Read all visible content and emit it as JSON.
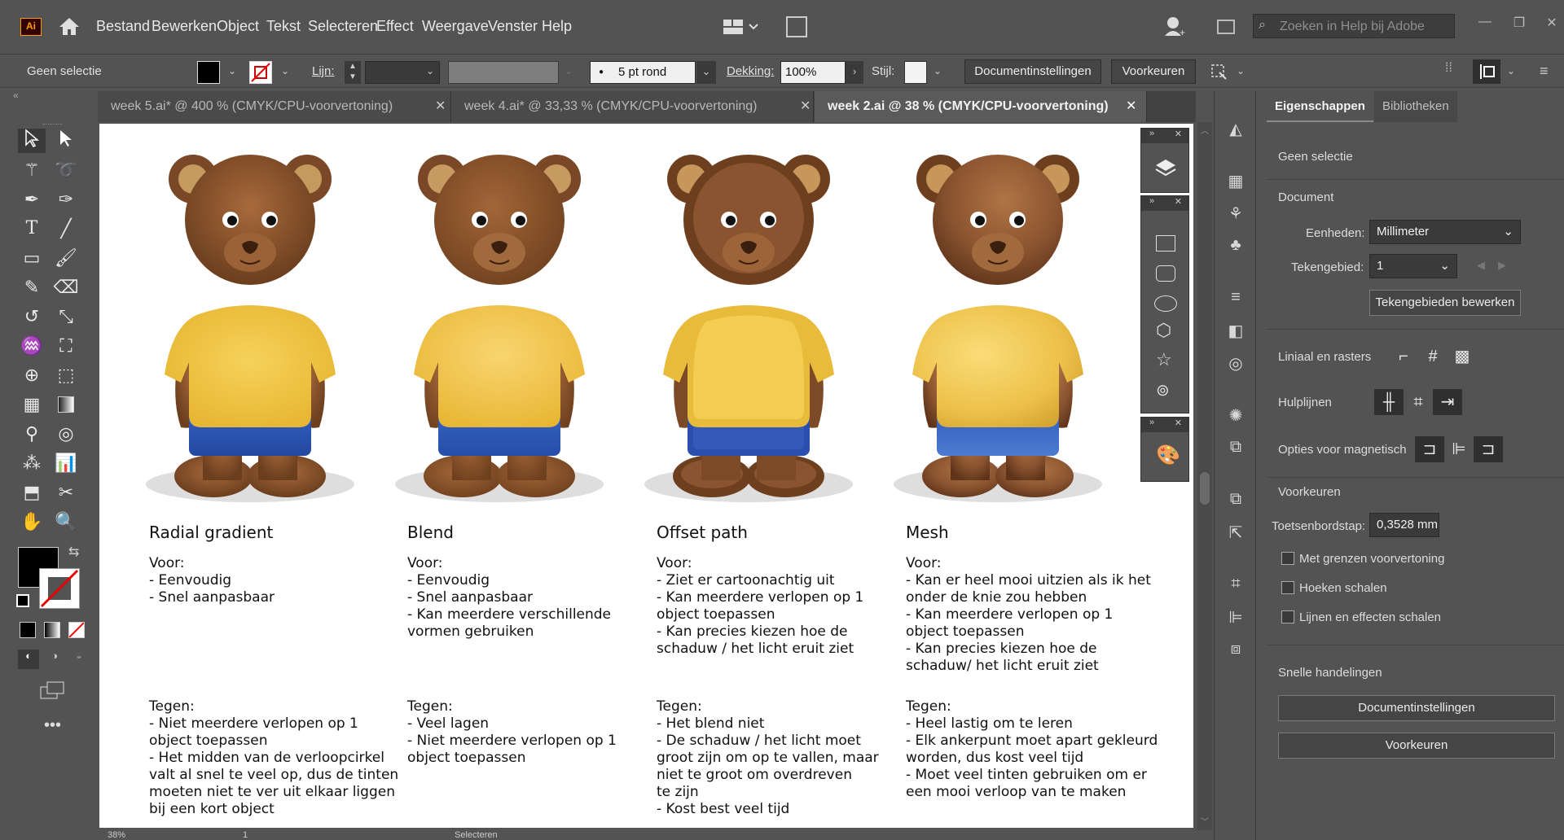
{
  "app": {
    "logo": "Ai"
  },
  "menu": [
    "Bestand",
    "Bewerken",
    "Object",
    "Tekst",
    "Selecteren",
    "Effect",
    "Weergave",
    "Venster",
    "Help"
  ],
  "search": {
    "placeholder": "Zoeken in Help bij Adobe"
  },
  "control": {
    "selection_label": "Geen selectie",
    "stroke_label": "Lijn:",
    "brush_value": "5 pt rond",
    "opacity_label": "Dekking:",
    "opacity_value": "100%",
    "style_label": "Stijl:",
    "doc_settings": "Documentinstellingen",
    "preferences": "Voorkeuren"
  },
  "tabs": [
    {
      "label": "week 5.ai* @ 400 % (CMYK/CPU-voorvertoning)",
      "active": false
    },
    {
      "label": "week 4.ai* @ 33,33 % (CMYK/CPU-voorvertoning)",
      "active": false
    },
    {
      "label": "week 2.ai @ 38 % (CMYK/CPU-voorvertoning)",
      "active": true
    }
  ],
  "artboard": {
    "columns": [
      {
        "title": "Radial gradient",
        "pros_head": "Voor:",
        "pros": "- Eenvoudig\n- Snel aanpasbaar",
        "cons_head": "Tegen:",
        "cons": "- Niet meerdere verlopen op 1\nobject toepassen\n- Het midden van de verloopcirkel\nvalt al snel te veel op, dus de tinten\nmoeten niet te ver uit elkaar liggen\nbij een kort object"
      },
      {
        "title": "Blend",
        "pros_head": "Voor:",
        "pros": "- Eenvoudig\n- Snel aanpasbaar\n- Kan meerdere verschillende\nvormen gebruiken",
        "cons_head": "Tegen:",
        "cons": "- Veel lagen\n- Niet meerdere verlopen op 1\nobject toepassen"
      },
      {
        "title": "Offset path",
        "pros_head": "Voor:",
        "pros": "- Ziet er cartoonachtig uit\n- Kan meerdere verlopen op 1\nobject toepassen\n- Kan precies kiezen hoe de\nschaduw / het licht eruit ziet",
        "cons_head": "Tegen:",
        "cons": "- Het blend niet\n- De schaduw / het licht moet\ngroot zijn om op te vallen, maar\nniet te groot om overdreven\nte zijn\n- Kost best veel tijd"
      },
      {
        "title": "Mesh",
        "pros_head": "Voor:",
        "pros": "- Kan er heel mooi uitzien als ik het\nonder de knie zou hebben\n- Kan meerdere verlopen op 1\nobject toepassen\n- Kan precies kiezen hoe de\nschaduw/ het licht eruit ziet",
        "cons_head": "Tegen:",
        "cons": "- Heel lastig om te leren\n- Elk ankerpunt moet apart gekleurd\nworden, dus kost veel tijd\n- Moet veel tinten gebruiken om er\neen mooi verloop van te maken"
      }
    ]
  },
  "status": {
    "zoom": "38%",
    "page": "1",
    "tool": "Selecteren"
  },
  "panel": {
    "tabs": [
      "Eigenschappen",
      "Bibliotheken"
    ],
    "no_selection": "Geen selectie",
    "document": "Document",
    "units_label": "Eenheden:",
    "units_value": "Millimeter",
    "artboard_label": "Tekengebied:",
    "artboard_value": "1",
    "edit_artboards": "Tekengebieden bewerken",
    "rulers": "Liniaal en rasters",
    "guides": "Hulplijnen",
    "snap": "Opties voor magnetisch",
    "prefs_head": "Voorkeuren",
    "keyboard_label": "Toetsenbordstap:",
    "keyboard_value": "0,3528 mm",
    "chk1": "Met grenzen voorvertoning",
    "chk2": "Hoeken schalen",
    "chk3": "Lijnen en effecten schalen",
    "quick": "Snelle handelingen",
    "quick_doc": "Documentinstellingen",
    "quick_prefs": "Voorkeuren"
  },
  "colors": {
    "accent": "#ff9a00",
    "shirt": "#f2c84b",
    "shorts": "#2f58b6",
    "fur": "#8a5430"
  }
}
